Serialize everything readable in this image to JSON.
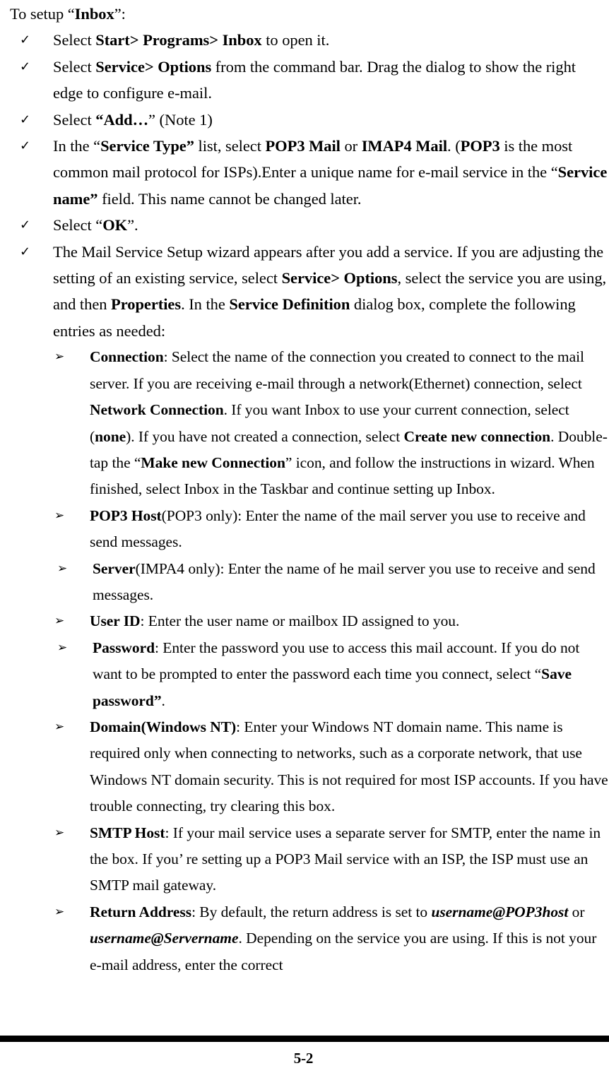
{
  "document": {
    "intro": "To setup “Inbox”:",
    "intro_bold_part": "Inbox"
  },
  "bullets": {
    "check_glyph": "✓",
    "arrow_glyph": "➢"
  },
  "steps": [
    {
      "id": "step-open-inbox",
      "segments": [
        {
          "text": "Select ",
          "style": "normal"
        },
        {
          "text": "Start> Programs> Inbox",
          "style": "bold"
        },
        {
          "text": " to open it.",
          "style": "normal"
        }
      ]
    },
    {
      "id": "step-service-options",
      "segments": [
        {
          "text": "Select ",
          "style": "normal"
        },
        {
          "text": "Service> Options",
          "style": "bold"
        },
        {
          "text": " from the command bar. Drag the dialog to show the right edge to configure e-mail.",
          "style": "normal"
        }
      ]
    },
    {
      "id": "step-add",
      "segments": [
        {
          "text": "Select ",
          "style": "normal"
        },
        {
          "text": "“Add…",
          "style": "bold"
        },
        {
          "text": "” (Note 1)",
          "style": "normal"
        }
      ]
    },
    {
      "id": "step-service-type",
      "segments": [
        {
          "text": "In the “",
          "style": "normal"
        },
        {
          "text": "Service Type”",
          "style": "bold"
        },
        {
          "text": " list, select ",
          "style": "normal"
        },
        {
          "text": "POP3 Mail",
          "style": "bold"
        },
        {
          "text": " or ",
          "style": "normal"
        },
        {
          "text": "IMAP4 Mail",
          "style": "bold"
        },
        {
          "text": ". (",
          "style": "normal"
        },
        {
          "text": "POP3",
          "style": "bold"
        },
        {
          "text": " is the most common mail protocol for ISPs).Enter a unique name for e-mail service in the “",
          "style": "normal"
        },
        {
          "text": "Service name”",
          "style": "bold"
        },
        {
          "text": " field. This name cannot be changed later.",
          "style": "normal"
        }
      ]
    },
    {
      "id": "step-ok",
      "segments": [
        {
          "text": "Select “",
          "style": "normal"
        },
        {
          "text": "OK",
          "style": "bold"
        },
        {
          "text": "”.",
          "style": "normal"
        }
      ]
    },
    {
      "id": "step-mail-service-setup-wizard",
      "segments": [
        {
          "text": "The Mail Service Setup wizard appears after you add a service. If you are adjusting the setting of an existing service, select ",
          "style": "normal"
        },
        {
          "text": "Service> Options",
          "style": "bold"
        },
        {
          "text": ", select the service you are using, and then ",
          "style": "normal"
        },
        {
          "text": "Properties",
          "style": "bold"
        },
        {
          "text": ". In the ",
          "style": "normal"
        },
        {
          "text": "Service Definition",
          "style": "bold"
        },
        {
          "text": " dialog box, complete the following entries as needed:",
          "style": "normal"
        }
      ]
    }
  ],
  "entries": [
    {
      "id": "entry-connection",
      "indent_more": false,
      "segments": [
        {
          "text": "Connection",
          "style": "bold"
        },
        {
          "text": ": Select the name of the connection you created to connect to the mail server. If you are receiving e-mail through a network(Ethernet) connection, select ",
          "style": "normal"
        },
        {
          "text": "Network Connection",
          "style": "bold"
        },
        {
          "text": ". If you want Inbox to use your current connection, select (",
          "style": "normal"
        },
        {
          "text": "none",
          "style": "bold"
        },
        {
          "text": "). If you have not created a connection, select ",
          "style": "normal"
        },
        {
          "text": "Create new connection",
          "style": "bold"
        },
        {
          "text": ". Double-tap the “",
          "style": "normal"
        },
        {
          "text": "Make new Connection",
          "style": "bold"
        },
        {
          "text": "” icon, and follow the instructions in wizard. When finished, select Inbox in the Taskbar and continue setting up Inbox.",
          "style": "normal"
        }
      ]
    },
    {
      "id": "entry-pop3-host",
      "indent_more": false,
      "segments": [
        {
          "text": "POP3 Host",
          "style": "bold"
        },
        {
          "text": "(POP3 only): Enter the name of the mail server you use to receive and send messages.",
          "style": "normal"
        }
      ]
    },
    {
      "id": "entry-server",
      "indent_more": true,
      "segments": [
        {
          "text": "Server",
          "style": "bold"
        },
        {
          "text": "(IMPA4 only): Enter the name of he mail server you use to receive and send messages.",
          "style": "normal"
        }
      ]
    },
    {
      "id": "entry-user-id",
      "indent_more": false,
      "segments": [
        {
          "text": "User ID",
          "style": "bold"
        },
        {
          "text": ": Enter the user name or mailbox ID assigned to you.",
          "style": "normal"
        }
      ]
    },
    {
      "id": "entry-password",
      "indent_more": true,
      "segments": [
        {
          "text": "Password",
          "style": "bold"
        },
        {
          "text": ": Enter the password you use to access this mail account. If you do not want to be prompted to enter the password each time you connect, select “",
          "style": "normal"
        },
        {
          "text": "Save password”",
          "style": "bold"
        },
        {
          "text": ".",
          "style": "normal"
        }
      ]
    },
    {
      "id": "entry-domain-windows-nt",
      "indent_more": false,
      "segments": [
        {
          "text": "Domain(Windows NT)",
          "style": "bold"
        },
        {
          "text": ": Enter your Windows NT domain name. This name is required only when connecting to networks, such as a corporate network, that use Windows NT domain security. This is not required for most ISP accounts. If you have trouble connecting, try clearing this box.",
          "style": "normal"
        }
      ]
    },
    {
      "id": "entry-smtp-host",
      "indent_more": false,
      "segments": [
        {
          "text": "SMTP Host",
          "style": "bold"
        },
        {
          "text": ": If your mail service uses a separate server for SMTP, enter the name in the box. If you’ re setting up a POP3 Mail service with an ISP, the ISP must use an SMTP mail gateway.",
          "style": "normal"
        }
      ]
    },
    {
      "id": "entry-return-address",
      "indent_more": false,
      "segments": [
        {
          "text": "Return Address",
          "style": "bold"
        },
        {
          "text": ": By default, the return address is set to ",
          "style": "normal"
        },
        {
          "text": "username@POP3host",
          "style": "bolditalic"
        },
        {
          "text": " or ",
          "style": "normal"
        },
        {
          "text": "username@Servername",
          "style": "bolditalic"
        },
        {
          "text": ". Depending on the service you are using. If this is not your e-mail address, enter the correct",
          "style": "normal"
        }
      ]
    }
  ],
  "footer": {
    "page_number": "5-2"
  }
}
